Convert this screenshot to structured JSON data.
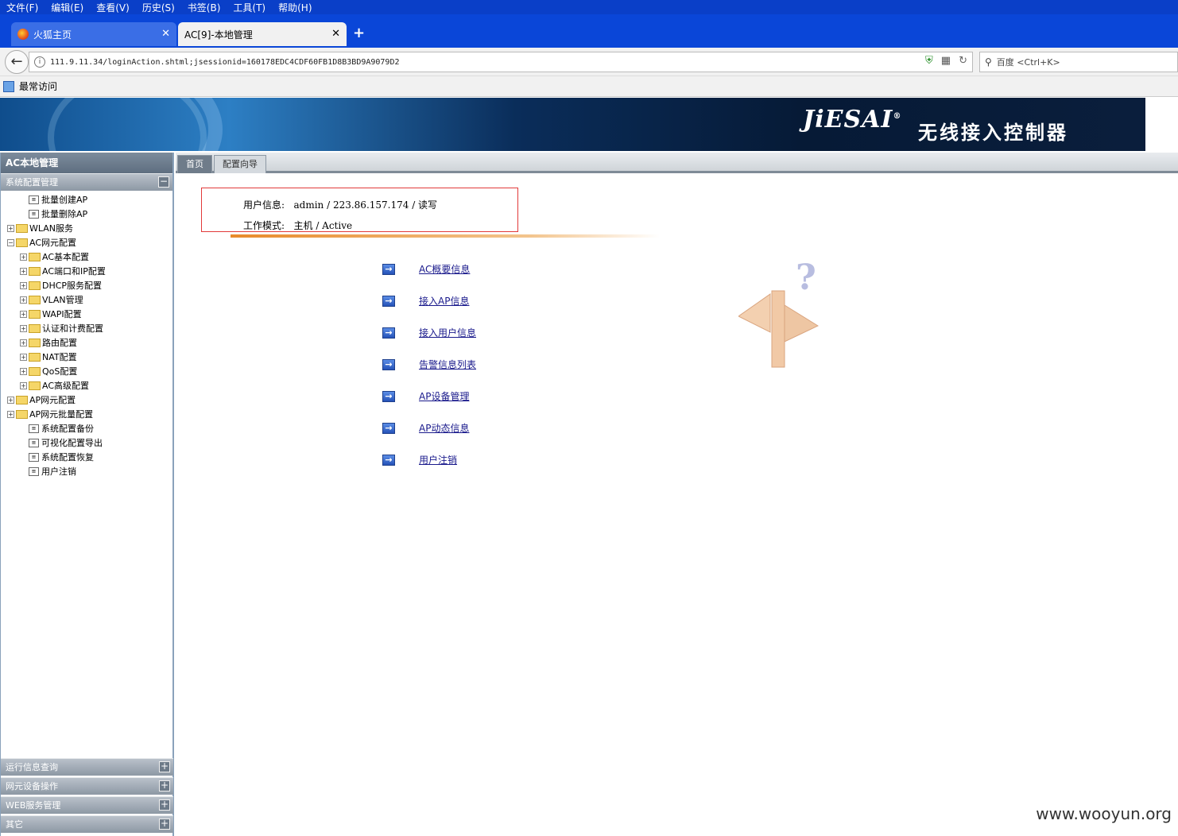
{
  "menu": [
    "文件(F)",
    "编辑(E)",
    "查看(V)",
    "历史(S)",
    "书签(B)",
    "工具(T)",
    "帮助(H)"
  ],
  "tabs": [
    {
      "label": "火狐主页"
    },
    {
      "label": "AC[9]-本地管理"
    }
  ],
  "url": "111.9.11.34/loginAction.shtml;jsessionid=160178EDC4CDF60FB1D8B3BD9A9079D2",
  "search_placeholder": "百度 <Ctrl+K>",
  "bookmark": "最常访问",
  "banner": {
    "logo": "JiESAI",
    "product": "无线接入控制器"
  },
  "sidebar": {
    "title": "AC本地管理",
    "group_active": "系统配置管理",
    "tree": [
      {
        "level": 1,
        "type": "doc",
        "label": "批量创建AP"
      },
      {
        "level": 1,
        "type": "doc",
        "label": "批量删除AP"
      },
      {
        "level": 0,
        "type": "folder",
        "pm": "+",
        "label": "WLAN服务"
      },
      {
        "level": 0,
        "type": "folder",
        "pm": "-",
        "label": "AC网元配置"
      },
      {
        "level": 1,
        "type": "folder",
        "pm": "+",
        "label": "AC基本配置"
      },
      {
        "level": 1,
        "type": "folder",
        "pm": "+",
        "label": "AC端口和IP配置"
      },
      {
        "level": 1,
        "type": "folder",
        "pm": "+",
        "label": "DHCP服务配置"
      },
      {
        "level": 1,
        "type": "folder",
        "pm": "+",
        "label": "VLAN管理"
      },
      {
        "level": 1,
        "type": "folder",
        "pm": "+",
        "label": "WAPI配置"
      },
      {
        "level": 1,
        "type": "folder",
        "pm": "+",
        "label": "认证和计费配置"
      },
      {
        "level": 1,
        "type": "folder",
        "pm": "+",
        "label": "路由配置"
      },
      {
        "level": 1,
        "type": "folder",
        "pm": "+",
        "label": "NAT配置"
      },
      {
        "level": 1,
        "type": "folder",
        "pm": "+",
        "label": "QoS配置"
      },
      {
        "level": 1,
        "type": "folder",
        "pm": "+",
        "label": "AC高级配置"
      },
      {
        "level": 0,
        "type": "folder",
        "pm": "+",
        "label": "AP网元配置"
      },
      {
        "level": 0,
        "type": "folder",
        "pm": "+",
        "label": "AP网元批量配置"
      },
      {
        "level": 1,
        "type": "doc",
        "label": "系统配置备份"
      },
      {
        "level": 1,
        "type": "doc",
        "label": "可视化配置导出"
      },
      {
        "level": 1,
        "type": "doc",
        "label": "系统配置恢复"
      },
      {
        "level": 1,
        "type": "doc",
        "label": "用户注销"
      }
    ],
    "bottom_groups": [
      "运行信息查询",
      "网元设备操作",
      "WEB服务管理",
      "其它"
    ]
  },
  "page_tabs": [
    "首页",
    "配置向导"
  ],
  "info": {
    "user_label": "用户信息:",
    "user_value": "admin / 223.86.157.174 / 读写",
    "mode_label": "工作模式:",
    "mode_value": "主机 / Active"
  },
  "links": [
    "AC概要信息",
    "接入AP信息",
    "接入用户信息",
    "告警信息列表",
    "AP设备管理",
    "AP动态信息",
    "用户注销"
  ],
  "watermark": "www.wooyun.org"
}
